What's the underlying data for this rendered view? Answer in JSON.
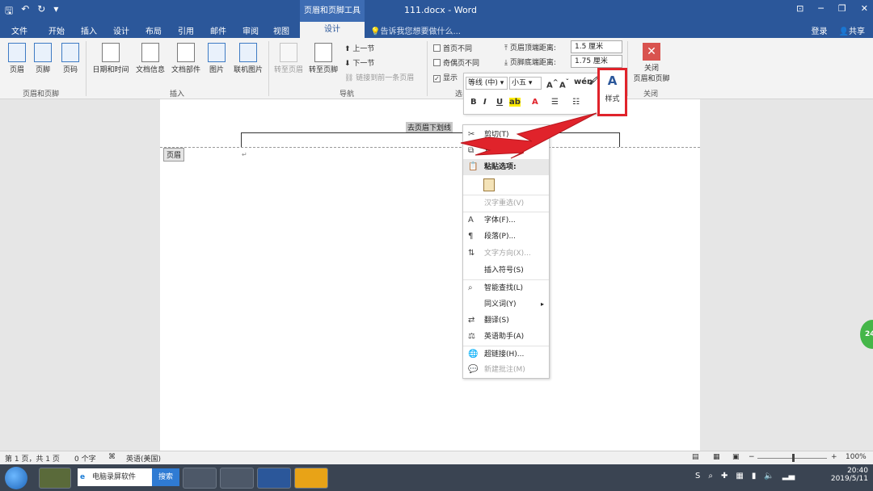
{
  "titlebar": {
    "context_tool": "页眉和页脚工具",
    "doc_title": "111.docx - Word",
    "qat": [
      "save-icon",
      "undo-icon",
      "redo-icon",
      "customize-icon"
    ]
  },
  "tabs": [
    {
      "label": "文件"
    },
    {
      "label": "开始"
    },
    {
      "label": "插入"
    },
    {
      "label": "设计"
    },
    {
      "label": "布局"
    },
    {
      "label": "引用"
    },
    {
      "label": "邮件"
    },
    {
      "label": "审阅"
    },
    {
      "label": "视图"
    },
    {
      "label": "设计",
      "active": true
    }
  ],
  "tellme": "告诉我您想要做什么...",
  "account": {
    "login": "登录",
    "share": "共享"
  },
  "ribbon": {
    "group_header_footer": {
      "name": "页眉和页脚",
      "buttons": [
        "页眉",
        "页脚",
        "页码"
      ]
    },
    "group_insert": {
      "name": "插入",
      "buttons": [
        "日期和时间",
        "文档信息",
        "文档部件",
        "图片",
        "联机图片"
      ]
    },
    "group_nav": {
      "name": "导航",
      "buttons": [
        "转至页眉",
        "转至页脚"
      ],
      "small": [
        "上一节",
        "下一节",
        "链接到前一条页眉"
      ]
    },
    "group_options": {
      "name": "选",
      "checks": [
        "首页不同",
        "奇偶页不同",
        "显示"
      ]
    },
    "group_position": {
      "header_top_label": "页眉顶端距离:",
      "header_top_value": "1.5 厘米",
      "footer_bottom_label": "页脚底端距离:",
      "footer_bottom_value": "1.75 厘米"
    },
    "group_close": {
      "name": "关闭",
      "button": "关闭\n页眉和页脚",
      "button_line1": "关闭",
      "button_line2": "页眉和页脚"
    }
  },
  "minibar": {
    "font": "等线 (中)",
    "size": "小五",
    "style_label": "样式"
  },
  "document": {
    "header_text": "去页眉下划线",
    "header_tag": "页眉"
  },
  "context_menu": {
    "items": [
      {
        "label": "剪切(T)",
        "icon": "scissors-icon",
        "dim": false
      },
      {
        "label": "复制(C)",
        "icon": "copy-icon",
        "dim": false
      },
      {
        "label": "粘贴选项:",
        "icon": "paste-icon",
        "dim": false
      },
      {
        "label": "汉字重选(V)",
        "dim": true
      },
      {
        "label": "字体(F)...",
        "icon": "font-icon",
        "dim": false
      },
      {
        "label": "段落(P)...",
        "icon": "paragraph-icon",
        "dim": false
      },
      {
        "label": "文字方向(X)...",
        "icon": "text-direction-icon",
        "dim": true
      },
      {
        "label": "插入符号(S)",
        "dim": false
      },
      {
        "label": "智能查找(L)",
        "icon": "smart-lookup-icon",
        "dim": false
      },
      {
        "label": "同义词(Y)",
        "dim": false
      },
      {
        "label": "翻译(S)",
        "icon": "translate-icon",
        "dim": false
      },
      {
        "label": "英语助手(A)",
        "icon": "english-assistant-icon",
        "dim": false
      },
      {
        "label": "超链接(H)...",
        "icon": "hyperlink-icon",
        "dim": false
      },
      {
        "label": "新建批注(M)",
        "icon": "comment-icon",
        "dim": true
      }
    ]
  },
  "statusbar": {
    "page": "第 1 页，共 1 页",
    "words": "0 个字",
    "language": "英语(美国)",
    "zoom": "100%"
  },
  "taskbar": {
    "search_placeholder": "电脑录屏软件",
    "search_button": "搜索",
    "time": "20:40",
    "date": "2019/5/11"
  },
  "colors": {
    "accent": "#2b579a",
    "highlight": "#e0232b"
  }
}
